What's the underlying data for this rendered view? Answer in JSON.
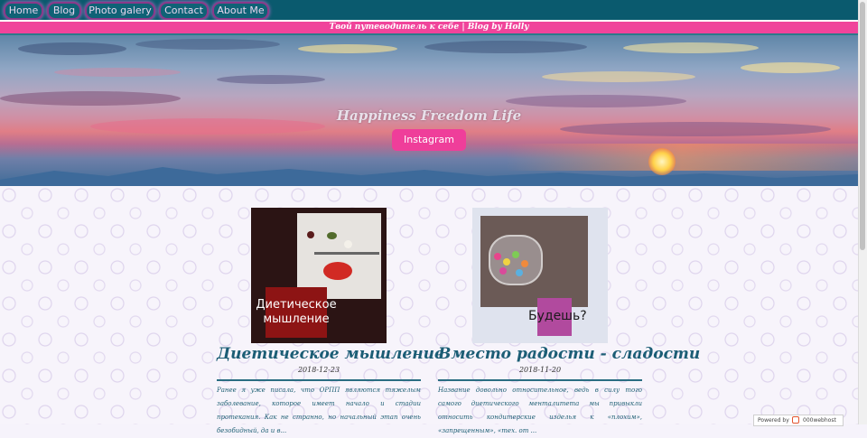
{
  "nav": {
    "items": [
      {
        "label": "Home"
      },
      {
        "label": "Blog"
      },
      {
        "label": "Photo galery"
      },
      {
        "label": "Contact"
      },
      {
        "label": "About Me"
      }
    ]
  },
  "tagline": "Твой путеводитель к себе | Blog by Holly",
  "hero": {
    "title": "Happiness Freedom Life",
    "button_label": "Instagram"
  },
  "posts": [
    {
      "thumb_caption": "Диетическое мышление",
      "title": "Диетическое мышление",
      "date": "2018-12-23",
      "excerpt": "Ранее я уже писала, что ОРПП являются тяжелым заболевание, которое имеет начало и стадии протекания. Как не странно, но начальный этап очень безобидный, да и в..."
    },
    {
      "thumb_caption": "Будешь?",
      "title": "Вместо радости - сладости",
      "date": "2018-11-20",
      "excerpt": "Название довольно относительное, ведь в силу того самого диетического менталитета мы привыкли относить кондитерские изделья к «плохим», «запрещенным», «тех. от ..."
    }
  ],
  "footer": {
    "powered_label": "Powered by",
    "host_label": "000webhost"
  },
  "colors": {
    "nav_bg": "#0a5a6e",
    "accent_pink": "#f0449b",
    "title_blue": "#1b5d75"
  }
}
